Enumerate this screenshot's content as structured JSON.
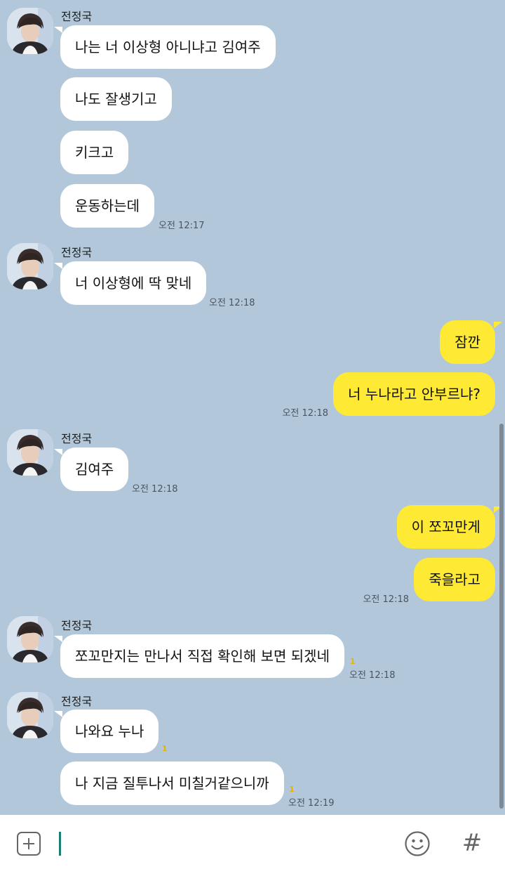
{
  "chat": {
    "messages": [
      {
        "sender": "전정국",
        "text": "나는 너 이상형 아니냐고 김여주"
      },
      {
        "text": "나도 잘생기고"
      },
      {
        "text": "키크고"
      },
      {
        "text": "운동하는데",
        "time": "오전 12:17"
      },
      {
        "sender": "전정국",
        "text": "너 이상형에 딱 맞네",
        "time": "오전 12:18"
      },
      {
        "text": "잠깐",
        "mine": true
      },
      {
        "text": "너 누나라고 안부르냐?",
        "mine": true,
        "time": "오전 12:18"
      },
      {
        "sender": "전정국",
        "text": "김여주",
        "time": "오전 12:18"
      },
      {
        "text": "이 쪼꼬만게",
        "mine": true
      },
      {
        "text": "죽을라고",
        "mine": true,
        "time": "오전 12:18"
      },
      {
        "sender": "전정국",
        "text": "쪼꼬만지는 만나서 직접 확인해 보면 되겠네",
        "unread": "1",
        "time": "오전 12:18"
      },
      {
        "sender": "전정국",
        "text": "나와요 누나",
        "unread": "1"
      },
      {
        "text": "나 지금 질투나서 미칠거같으니까",
        "unread": "1",
        "time": "오전 12:19"
      }
    ]
  },
  "input": {
    "value": "",
    "plus_icon": "plus-square-icon",
    "emoji_icon": "smiley-icon",
    "hash_label": "#"
  },
  "colors": {
    "background": "#b2c7d9",
    "incoming_bubble": "#ffffff",
    "outgoing_bubble": "#fee934",
    "unread": "#e6b400"
  }
}
